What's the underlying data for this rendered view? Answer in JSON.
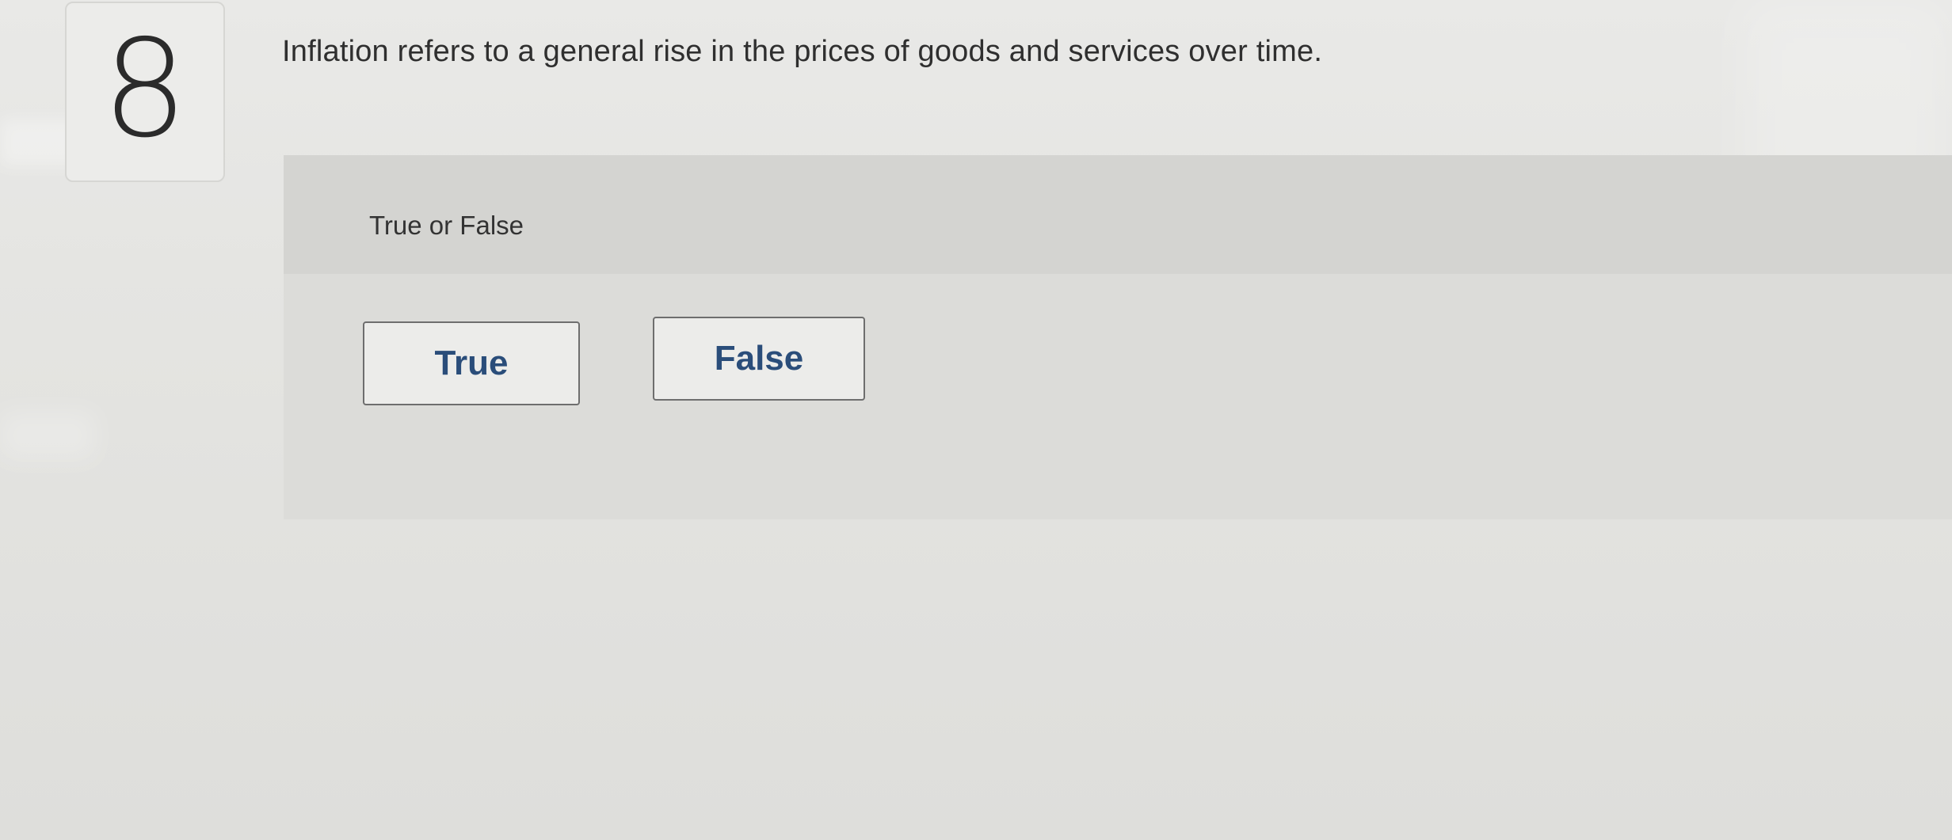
{
  "question": {
    "number": "8",
    "prompt": "Inflation refers to a general rise in the prices of goods and services over time."
  },
  "answer_area": {
    "type_label": "True or False",
    "choices": [
      {
        "label": "True"
      },
      {
        "label": "False"
      }
    ]
  },
  "colors": {
    "choice_text": "#2a4d7a",
    "choice_border": "#6e6e6e",
    "panel_background": "#dcdcd9"
  }
}
